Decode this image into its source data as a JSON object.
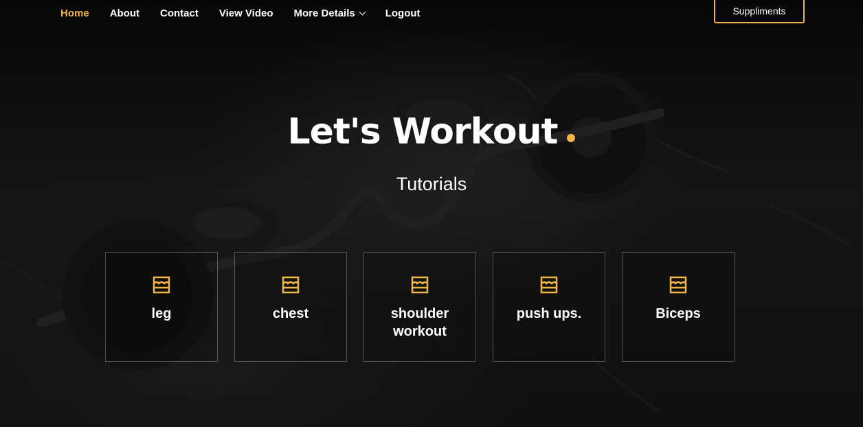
{
  "nav": {
    "links": [
      {
        "label": "Home",
        "active": true
      },
      {
        "label": "About",
        "active": false
      },
      {
        "label": "Contact",
        "active": false
      },
      {
        "label": "View Video",
        "active": false
      },
      {
        "label": "More Details",
        "active": false,
        "dropdown": true
      },
      {
        "label": "Logout",
        "active": false
      }
    ],
    "cta_label": "Suppliments"
  },
  "hero": {
    "title": "Let's Workout",
    "subtitle": "Tutorials"
  },
  "cards": [
    {
      "label": "leg",
      "icon": "store-icon"
    },
    {
      "label": "chest",
      "icon": "store-icon"
    },
    {
      "label": "shoulder workout",
      "icon": "store-icon"
    },
    {
      "label": "push ups.",
      "icon": "store-icon"
    },
    {
      "label": "Biceps",
      "icon": "store-icon"
    }
  ],
  "colors": {
    "accent": "#f2b54a",
    "text": "#ffffff",
    "background": "#0e0e0e"
  }
}
